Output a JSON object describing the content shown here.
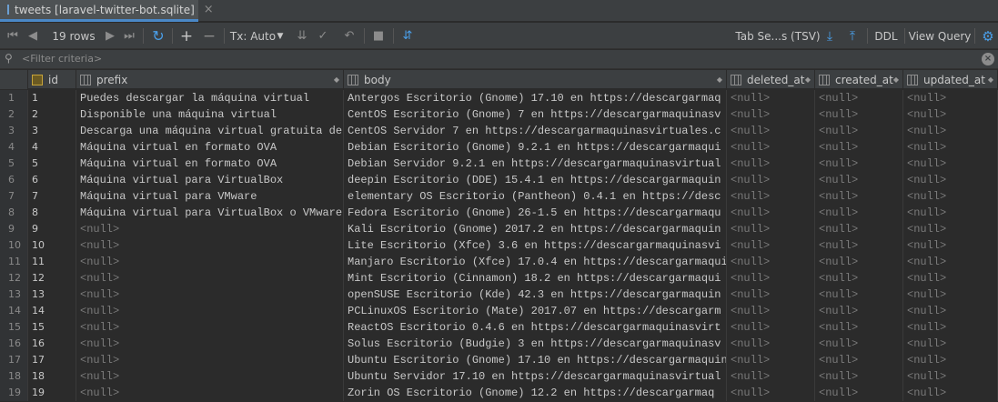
{
  "tab": {
    "title": "tweets [laravel-twitter-bot.sqlite]",
    "close": "×"
  },
  "toolbar": {
    "rows_label": "19 rows",
    "tx_label": "Tx: Auto",
    "tab_sep_label": "Tab Se...s (TSV)",
    "ddl_label": "DDL",
    "view_query_label": "View Query"
  },
  "filter": {
    "placeholder": "<Filter criteria>"
  },
  "columns": [
    {
      "name": "id"
    },
    {
      "name": "prefix"
    },
    {
      "name": "body"
    },
    {
      "name": "deleted_at"
    },
    {
      "name": "created_at"
    },
    {
      "name": "updated_at"
    }
  ],
  "rows": [
    {
      "n": "1",
      "id": "1",
      "prefix": "Puedes descargar la máquina virtual",
      "body": "Antergos Escritorio (Gnome) 17.10 en https://descargarmaq",
      "deleted_at": "<null>",
      "created_at": "<null>",
      "updated_at": "<null>"
    },
    {
      "n": "2",
      "id": "2",
      "prefix": "Disponible una máquina virtual",
      "body": "CentOS Escritorio (Gnome) 7 en https://descargarmaquinasv",
      "deleted_at": "<null>",
      "created_at": "<null>",
      "updated_at": "<null>"
    },
    {
      "n": "3",
      "id": "3",
      "prefix": "Descarga una máquina virtual gratuita de",
      "body": "CentOS Servidor 7 en https://descargarmaquinasvirtuales.c",
      "deleted_at": "<null>",
      "created_at": "<null>",
      "updated_at": "<null>"
    },
    {
      "n": "4",
      "id": "4",
      "prefix": "Máquina virtual en formato OVA",
      "body": "Debian Escritorio (Gnome) 9.2.1 en https://descargarmaqui",
      "deleted_at": "<null>",
      "created_at": "<null>",
      "updated_at": "<null>"
    },
    {
      "n": "5",
      "id": "5",
      "prefix": "Máquina virtual en formato OVA",
      "body": "Debian Servidor 9.2.1 en https://descargarmaquinasvirtual",
      "deleted_at": "<null>",
      "created_at": "<null>",
      "updated_at": "<null>"
    },
    {
      "n": "6",
      "id": "6",
      "prefix": "Máquina virtual para VirtualBox",
      "body": "deepin Escritorio (DDE) 15.4.1 en https://descargarmaquin",
      "deleted_at": "<null>",
      "created_at": "<null>",
      "updated_at": "<null>"
    },
    {
      "n": "7",
      "id": "7",
      "prefix": "Máquina virtual para VMware",
      "body": "elementary OS Escritorio (Pantheon) 0.4.1 en https://desc",
      "deleted_at": "<null>",
      "created_at": "<null>",
      "updated_at": "<null>"
    },
    {
      "n": "8",
      "id": "8",
      "prefix": "Máquina virtual para VirtualBox o VMware",
      "body": "Fedora Escritorio (Gnome) 26-1.5 en https://descargarmaqu",
      "deleted_at": "<null>",
      "created_at": "<null>",
      "updated_at": "<null>"
    },
    {
      "n": "9",
      "id": "9",
      "prefix": "<null>",
      "body": "Kali Escritorio (Gnome) 2017.2 en https://descargarmaquin",
      "deleted_at": "<null>",
      "created_at": "<null>",
      "updated_at": "<null>"
    },
    {
      "n": "10",
      "id": "10",
      "prefix": "<null>",
      "body": "Lite Escritorio (Xfce) 3.6 en https://descargarmaquinasvi",
      "deleted_at": "<null>",
      "created_at": "<null>",
      "updated_at": "<null>"
    },
    {
      "n": "11",
      "id": "11",
      "prefix": "<null>",
      "body": "Manjaro Escritorio (Xfce) 17.0.4 en https://descargarmaqui",
      "deleted_at": "<null>",
      "created_at": "<null>",
      "updated_at": "<null>"
    },
    {
      "n": "12",
      "id": "12",
      "prefix": "<null>",
      "body": "Mint Escritorio (Cinnamon) 18.2 en https://descargarmaqui",
      "deleted_at": "<null>",
      "created_at": "<null>",
      "updated_at": "<null>"
    },
    {
      "n": "13",
      "id": "13",
      "prefix": "<null>",
      "body": "openSUSE Escritorio (Kde) 42.3 en https://descargarmaquin",
      "deleted_at": "<null>",
      "created_at": "<null>",
      "updated_at": "<null>"
    },
    {
      "n": "14",
      "id": "14",
      "prefix": "<null>",
      "body": "PCLinuxOS Escritorio (Mate) 2017.07 en https://descargarm",
      "deleted_at": "<null>",
      "created_at": "<null>",
      "updated_at": "<null>"
    },
    {
      "n": "15",
      "id": "15",
      "prefix": "<null>",
      "body": "ReactOS Escritorio 0.4.6 en https://descargarmaquinasvirt",
      "deleted_at": "<null>",
      "created_at": "<null>",
      "updated_at": "<null>"
    },
    {
      "n": "16",
      "id": "16",
      "prefix": "<null>",
      "body": "Solus Escritorio (Budgie) 3 en https://descargarmaquinasv",
      "deleted_at": "<null>",
      "created_at": "<null>",
      "updated_at": "<null>"
    },
    {
      "n": "17",
      "id": "17",
      "prefix": "<null>",
      "body": "Ubuntu Escritorio (Gnome) 17.10 en https://descargarmaquin",
      "deleted_at": "<null>",
      "created_at": "<null>",
      "updated_at": "<null>"
    },
    {
      "n": "18",
      "id": "18",
      "prefix": "<null>",
      "body": "Ubuntu Servidor 17.10 en https://descargarmaquinasvirtual",
      "deleted_at": "<null>",
      "created_at": "<null>",
      "updated_at": "<null>"
    },
    {
      "n": "19",
      "id": "19",
      "prefix": "<null>",
      "body": "Zorin OS Escritorio (Gnome) 12.2 en https://descargarmaq",
      "deleted_at": "<null>",
      "created_at": "<null>",
      "updated_at": "<null>"
    }
  ],
  "colors": {
    "background": "#2b2b2b",
    "toolbar": "#3c3f41",
    "accent": "#4a88c7",
    "null_text": "#7a7a7a"
  }
}
